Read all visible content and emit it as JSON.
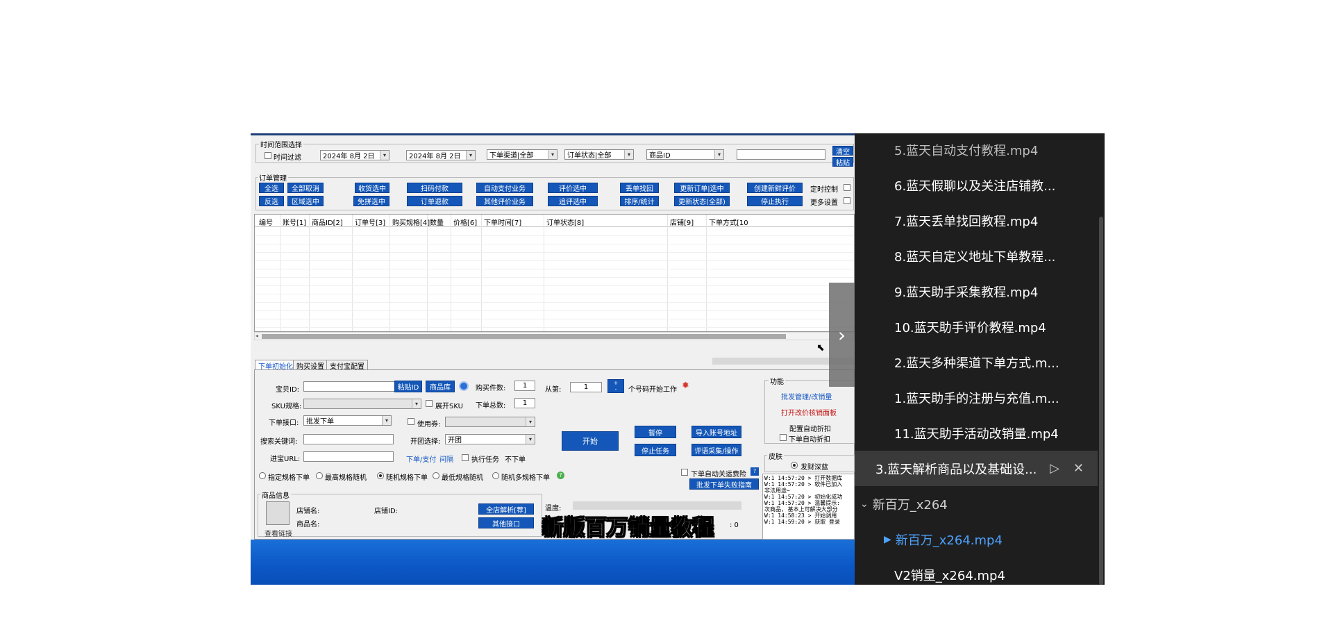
{
  "app": {
    "time_range": {
      "title": "时间范围选择",
      "time_filter_label": "时间过滤",
      "date_from": "2024年 8月 2日",
      "date_to": "2024年 8月 2日",
      "channel": "下单渠道|全部",
      "order_status": "订单状态|全部",
      "product_id": "商品ID",
      "clear_label": "清空",
      "paste_label": "粘贴"
    },
    "order_mgmt": {
      "title": "订单管理",
      "buttons_row1": [
        "全选",
        "全部取消",
        "收货选中",
        "扫码付款",
        "自动支付业务",
        "评价选中",
        "丢单找回",
        "更新订单|选中",
        "创建新鲜评价"
      ],
      "buttons_row2": [
        "反选",
        "区域选中",
        "免拼选中",
        "订单退款",
        "其他评价业务",
        "追评选中",
        "排序/统计",
        "更新状态(全部)",
        "停止执行"
      ],
      "timer_label": "定时控制",
      "more_label": "更多设置"
    },
    "grid": {
      "columns": [
        "编号",
        "账号[1]",
        "商品ID[2]",
        "订单号[3]",
        "购买规格[4]",
        "数量",
        "价格[6]",
        "下单时间[7]",
        "订单状态[8]",
        "店铺[9]",
        "下单方式[10"
      ]
    },
    "tabs": [
      "下单初始化",
      "购买设置",
      "支付宝配置"
    ],
    "form": {
      "item_id_label": "宝贝ID:",
      "paste_id_btn": "粘贴ID",
      "product_lib_btn": "商品库",
      "buy_count_label": "购买件数:",
      "buy_count_val": "1",
      "from_label": "从第:",
      "from_val": "1",
      "start_work_label": "个号码开始工作",
      "sku_label": "SKU规格:",
      "expand_sku_label": "展开SKU",
      "total_label": "下单总数:",
      "total_val": "1",
      "api_label": "下单接口:",
      "api_val": "批发下单",
      "coupon_label": "使用券:",
      "keyword_label": "搜索关键词:",
      "group_label": "开团选择:",
      "group_val": "开团",
      "url_label": "进宝URL:",
      "order_pay_label": "下单/支付",
      "interval_label": "间隔",
      "exec_task_label": "执行任务",
      "no_order_label": "不下单",
      "start_btn": "开始",
      "pause_btn": "暂停",
      "stop_btn": "停止任务",
      "import_btn": "导入账号地址",
      "review_btn": "评语采集/操作",
      "radios": [
        "指定规格下单",
        "最高规格随机",
        "随机规格下单",
        "最低规格随机",
        "随机多规格下单"
      ],
      "auto_close_label": "下单自动关运费险",
      "fail_guide_btn": "批发下单失败指南"
    },
    "product_info": {
      "title": "商品信息",
      "shop_name_label": "店铺名:",
      "shop_id_label": "店铺ID:",
      "product_name_label": "商品名:",
      "view_link_label": "查看链接",
      "analyze_btn": "全店解析[荐]",
      "other_api_btn": "其他接口",
      "status_label": "温度:",
      "count_val": ": 0"
    },
    "function_panel": {
      "title": "功能",
      "batch_label": "批发管理/改销量",
      "open_panel_label": "打开改价核销面板",
      "auto_discount_label": "配置自动折扣",
      "order_auto_discount_label": "下单自动折扣"
    },
    "skin": {
      "title": "皮肤",
      "value": "发财深蓝"
    },
    "log_lines": [
      "W:1 14:57:20 > 打开数据库",
      "W:1 14:57:20 > 软件已加入",
      "非法用途~",
      "W:1 14:57:20 > 初始化成功",
      "W:1 14:57:20 > 温馨提示:",
      "次商品, 基本上可解决大部分",
      "W:1 14:58:23 > 开始调用",
      "W:1 14:59:20 > 获取 登录"
    ]
  },
  "subtitle": "新版百万销量教程",
  "playlist": {
    "items": [
      {
        "label": "5.蓝天自动支付教程.mp4",
        "style": "dim"
      },
      {
        "label": "6.蓝天假聊以及关注店铺教...",
        "style": "normal"
      },
      {
        "label": "7.蓝天丢单找回教程.mp4",
        "style": "normal"
      },
      {
        "label": "8.蓝天自定义地址下单教程...",
        "style": "normal"
      },
      {
        "label": "9.蓝天助手采集教程.mp4",
        "style": "normal"
      },
      {
        "label": "10.蓝天助手评价教程.mp4",
        "style": "normal"
      },
      {
        "label": "2.蓝天多种渠道下单方式.m...",
        "style": "normal"
      },
      {
        "label": "1.蓝天助手的注册与充值.m...",
        "style": "normal"
      },
      {
        "label": "11.蓝天助手活动改销量.mp4",
        "style": "normal"
      },
      {
        "label": "3.蓝天解析商品以及基础设...",
        "style": "hl"
      },
      {
        "label": "新百万_x264",
        "style": "folder"
      },
      {
        "label": "新百万_x264.mp4",
        "style": "blue"
      },
      {
        "label": "V2销量_x264.mp4",
        "style": "normal"
      }
    ]
  }
}
